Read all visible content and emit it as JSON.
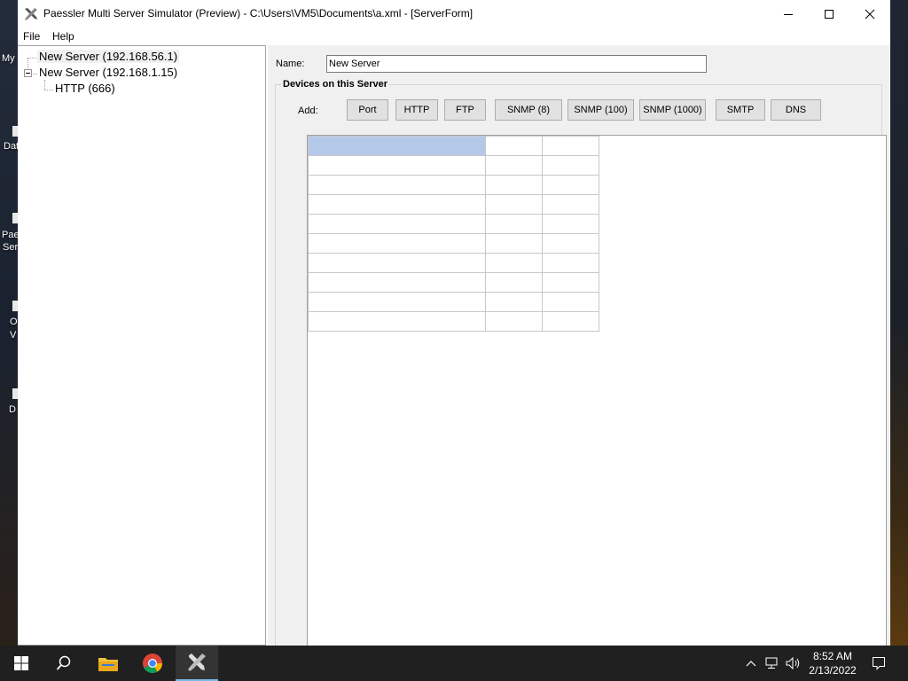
{
  "window": {
    "title": "Paessler Multi Server Simulator (Preview) - C:\\Users\\VM5\\Documents\\a.xml - [ServerForm]"
  },
  "menu": [
    "File",
    "Help"
  ],
  "desktop_labels": [
    "My",
    "Dat",
    "Pae",
    "Ser",
    "O",
    "V",
    "D"
  ],
  "tree": {
    "nodes": [
      {
        "label": "New Server (192.168.56.1)",
        "selected": true
      },
      {
        "label": "New Server (192.168.1.15)",
        "expanded": true
      },
      {
        "label": "HTTP (666)"
      }
    ]
  },
  "form": {
    "name_label": "Name:",
    "name_value": "New Server",
    "group_title": "Devices on this Server",
    "add_label": "Add:",
    "buttons": [
      "Port",
      "HTTP",
      "FTP",
      "SNMP (8)",
      "SNMP (100)",
      "SNMP (1000)",
      "SMTP",
      "DNS"
    ]
  },
  "taskbar": {
    "time": "8:52 AM",
    "date": "2/13/2022"
  },
  "colors": {
    "selection": "#b4c8e8",
    "taskbar": "#202020",
    "form_bg": "#f0f0f0"
  }
}
